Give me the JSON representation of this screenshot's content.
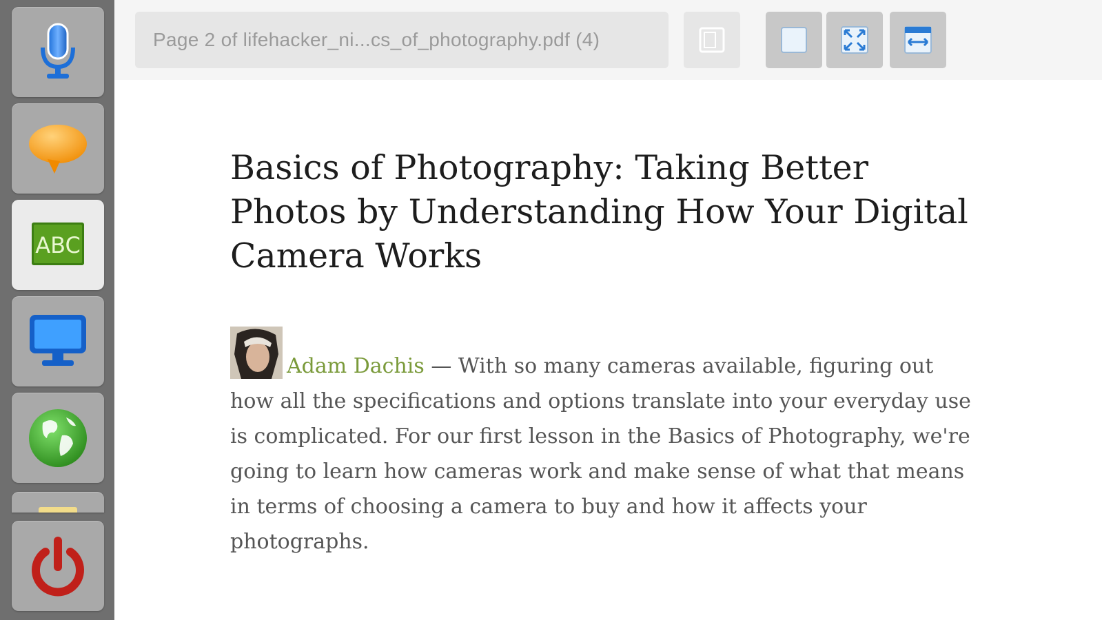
{
  "launcher": {
    "items": [
      {
        "name": "Microphone",
        "icon": "microphone-icon"
      },
      {
        "name": "Speech",
        "icon": "speech-bubble-icon"
      },
      {
        "name": "ABC",
        "icon": "abc-icon",
        "label": "ABC",
        "selected": true
      },
      {
        "name": "Monitor",
        "icon": "monitor-icon"
      },
      {
        "name": "Globe",
        "icon": "globe-icon"
      },
      {
        "name": "Partial",
        "icon": "folder-icon"
      },
      {
        "name": "Power",
        "icon": "power-icon"
      }
    ]
  },
  "toolbar": {
    "title": "Page 2 of lifehacker_ni...cs_of_photography.pdf (4)",
    "buttons": [
      {
        "icon": "page-view-icon"
      },
      {
        "icon": "single-page-icon"
      },
      {
        "icon": "fullscreen-icon"
      },
      {
        "icon": "fit-width-icon"
      }
    ]
  },
  "document": {
    "title": "Basics of Photography: Taking Better Photos by Understanding How Your Digital Camera Works",
    "author": "Adam Dachis",
    "separator": " — ",
    "body": "With so many cameras available, figuring out how all the specifications and options translate into your everyday use is complicated. For our first lesson in the Basics of Photography, we're going to learn how cameras work and make sense of what that means in terms of choosing a camera to buy and how it affects your photographs."
  },
  "colors": {
    "sidebar": "#6f6f6f",
    "tile": "#a9a9a9",
    "tile_selected": "#ebebeb",
    "author_link": "#7a9a3a",
    "abc_green": "#5aa020",
    "power_red": "#c0201a"
  }
}
